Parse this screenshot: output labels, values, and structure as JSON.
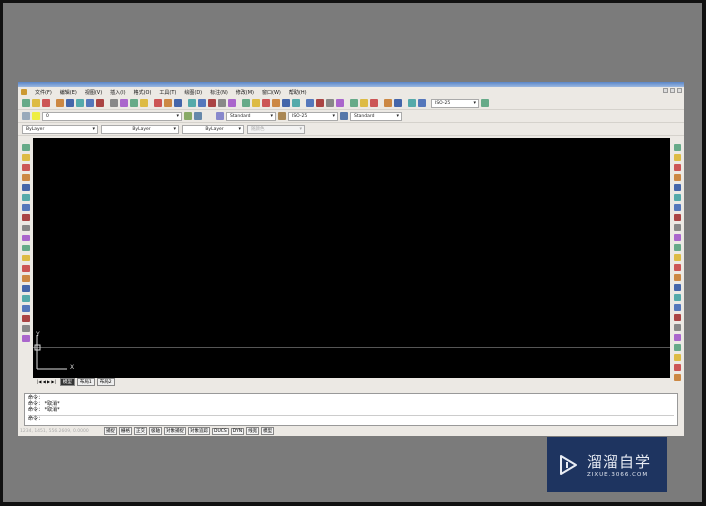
{
  "menu": [
    "文件(F)",
    "编辑(E)",
    "视图(V)",
    "插入(I)",
    "格式(O)",
    "工具(T)",
    "绘图(D)",
    "标注(N)",
    "修改(M)",
    "窗口(W)",
    "帮助(H)"
  ],
  "toolbar": {
    "dimstyle_top": "ISO-25",
    "layer": "0",
    "textstyle": "Standard",
    "dimstyle": "ISO-25",
    "tablestyle": "Standard"
  },
  "properties": {
    "color": "ByLayer",
    "linetype": "ByLayer",
    "lineweight": "ByLayer",
    "plotstyle": "随颜色"
  },
  "ucs": {
    "x": "X",
    "y": "Y"
  },
  "tabs": [
    "模型",
    "布局1",
    "布局2"
  ],
  "command_lines": [
    "命令：",
    "命令：  *取消*",
    "命令：  *取消*",
    "命令："
  ],
  "status": {
    "coords": "1234, 1451, 556.2609, 0.0000",
    "buttons": [
      "捕捉",
      "栅格",
      "正交",
      "极轴",
      "对象捕捉",
      "对象追踪",
      "DUCS",
      "DYN",
      "线宽",
      "模型"
    ]
  },
  "watermark": {
    "name": "溜溜自学",
    "url": "ZIXUE.3066.COM"
  },
  "colors": {
    "canvas": "#000000",
    "frame": "#7b7b7b",
    "watermark_bg": "#1e3460",
    "titlebar": "#5a86c8"
  }
}
